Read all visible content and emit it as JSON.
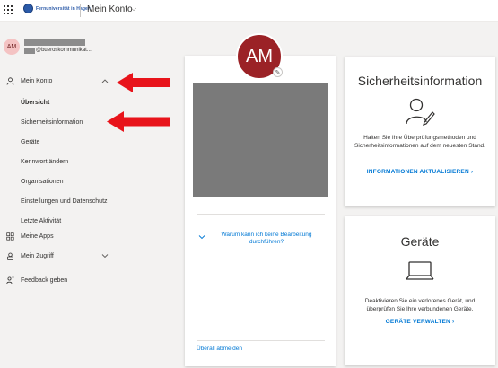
{
  "topbar": {
    "logo_text": "Fernuniversität in Hagen",
    "title": "Mein Konto",
    "title_chevron": "⌵"
  },
  "user": {
    "initials": "AM",
    "email_suffix": "@bueroskommunikat..."
  },
  "sidebar": {
    "mein_konto": "Mein Konto",
    "items": [
      {
        "label": "Übersicht",
        "active": true
      },
      {
        "label": "Sicherheitsinformation"
      },
      {
        "label": "Geräte"
      },
      {
        "label": "Kennwort ändern"
      },
      {
        "label": "Organisationen"
      },
      {
        "label": "Einstellungen und Datenschutz"
      },
      {
        "label": "Letzte Aktivität"
      }
    ],
    "meine_apps": "Meine Apps",
    "mein_zugriff": "Mein Zugriff",
    "feedback": "Feedback geben"
  },
  "profile_card": {
    "why_link": "Warum kann ich keine Bearbeitung durchführen?",
    "signout": "Überall abmelden"
  },
  "security_card": {
    "title": "Sicherheitsinformation",
    "description": "Halten Sie Ihre Überprüfungsmethoden und Sicherheitsinformationen auf dem neuesten Stand.",
    "link": "INFORMATIONEN AKTUALISIEREN  ›"
  },
  "devices_card": {
    "title": "Geräte",
    "description": "Deaktivieren Sie ein verlorenes Gerät, und überprüfen Sie Ihre verbundenen Geräte.",
    "link": "GERÄTE VERWALTEN  ›"
  },
  "colors": {
    "accent": "#0078d4",
    "avatar": "#9b2226",
    "arrow": "#e8141b"
  }
}
